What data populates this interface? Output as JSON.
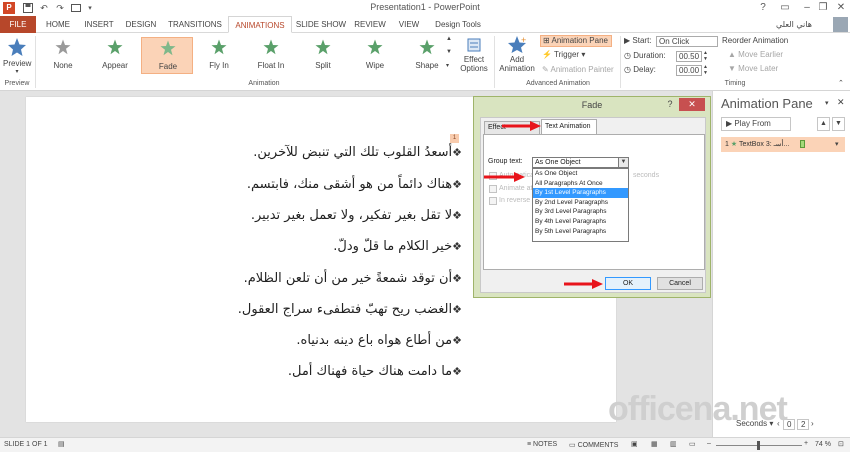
{
  "titlebar": {
    "title": "Presentation1 - PowerPoint",
    "help": "?",
    "minimize": "–",
    "restore": "❐",
    "close": "✕"
  },
  "tabs": [
    "FILE",
    "HOME",
    "INSERT",
    "DESIGN",
    "TRANSITIONS",
    "ANIMATIONS",
    "SLIDE SHOW",
    "REVIEW",
    "VIEW",
    "Design Tools"
  ],
  "user": "هاني العلي",
  "ribbon": {
    "preview": {
      "label": "Preview",
      "group": "Preview"
    },
    "animations": [
      {
        "label": "None",
        "color": "#9a9a9a"
      },
      {
        "label": "Appear",
        "color": "#5aa06a"
      },
      {
        "label": "Fade",
        "color": "#5aa06a"
      },
      {
        "label": "Fly In",
        "color": "#5aa06a"
      },
      {
        "label": "Float In",
        "color": "#5aa06a"
      },
      {
        "label": "Split",
        "color": "#5aa06a"
      },
      {
        "label": "Wipe",
        "color": "#5aa06a"
      },
      {
        "label": "Shape",
        "color": "#5aa06a"
      }
    ],
    "animation_group": "Animation",
    "effect_options": [
      "Effect",
      "Options"
    ],
    "add_animation": [
      "Add",
      "Animation"
    ],
    "animation_pane_btn": "Animation Pane",
    "trigger_btn": "Trigger",
    "animation_painter_btn": "Animation Painter",
    "advanced_group": "Advanced Animation",
    "start_label": "Start:",
    "start_value": "On Click",
    "duration_label": "Duration:",
    "duration_value": "00.50",
    "delay_label": "Delay:",
    "delay_value": "00.00",
    "reorder_label": "Reorder Animation",
    "move_earlier": "Move Earlier",
    "move_later": "Move Later",
    "timing_group": "Timing"
  },
  "slide": {
    "number_tag": "1",
    "bullets": [
      "أسعدُ القلوب تلك التي تنبض للآخرين.",
      "هناك دائماً من هو أشقى منك، فابتسم.",
      "لا تقل بغير تفكير، ولا تعمل بغير تدبير.",
      "خير الكلام ما قلّ ودلّ.",
      "أن توقد شمعةً خير من أن تلعن الظلام.",
      "الغضب ريح تهبّ فتطفىء سراج العقول.",
      "من أطاع هواه باع دينه بدنياه.",
      "ما دامت هناك حياة فهناك أمل."
    ],
    "bullet_mark": "❖"
  },
  "dialog": {
    "title": "Fade",
    "help": "?",
    "close": "✕",
    "tab_effect": "Effect",
    "tab_text": "Text Animation",
    "group_text_label": "Group text:",
    "group_text_value": "As One Object",
    "options": [
      "Automatically after",
      "Animate attached shape",
      "In reverse order"
    ],
    "seconds_label": "seconds",
    "list": [
      "As One Object",
      "All Paragraphs At Once",
      "By 1st Level Paragraphs",
      "By 2nd Level Paragraphs",
      "By 3rd Level Paragraphs",
      "By 4th Level Paragraphs",
      "By 5th Level Paragraphs"
    ],
    "selected_index": 2,
    "ok": "OK",
    "cancel": "Cancel"
  },
  "animation_pane": {
    "title": "Animation Pane",
    "play_from": "Play From",
    "item_number": "1",
    "item_label": "TextBox 3: أسـ...",
    "seconds": "Seconds",
    "page_a": "0",
    "page_b": "2"
  },
  "status": {
    "slide": "SLIDE 1 OF 1",
    "notes": "NOTES",
    "comments": "COMMENTS",
    "zoom": "74 %"
  },
  "watermark": "officena.net",
  "colors": {
    "accent": "#b7472a",
    "selected_anim": "#fbd3b7",
    "dialog_frame": "#d9e4c0",
    "list_highlight": "#3399ff",
    "arrow": "#e8141b"
  }
}
